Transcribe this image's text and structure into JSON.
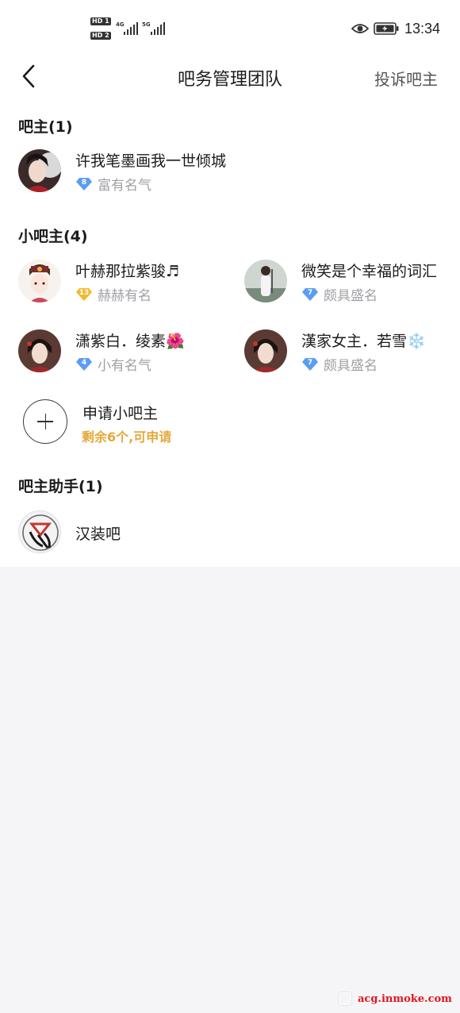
{
  "status_bar": {
    "hd1": "HD 1",
    "hd2": "HD 2",
    "net1": "4G",
    "net2": "5G",
    "time": "13:34",
    "icons": [
      "eye-icon",
      "battery-charging-icon"
    ]
  },
  "nav": {
    "title": "吧务管理团队",
    "complain": "投诉吧主"
  },
  "owner_section": {
    "title": "吧主(1)",
    "members": [
      {
        "name": "许我笔墨画我一世倾城",
        "level": "8",
        "level_title": "富有名气",
        "gem_color": "#5b9df2"
      }
    ]
  },
  "vice_section": {
    "title": "小吧主(4)",
    "members": [
      {
        "name": "叶赫那拉紫骏♬",
        "level": "13",
        "level_title": "赫赫有名",
        "gem_color": "#f3b92b"
      },
      {
        "name": "微笑是个幸福的词汇",
        "level": "7",
        "level_title": "颇具盛名",
        "gem_color": "#5b9df2"
      },
      {
        "name": "潇紫白．绫素🌺",
        "level": "4",
        "level_title": "小有名气",
        "gem_color": "#5b9df2"
      },
      {
        "name": "漢家女主．若雪❄️",
        "level": "7",
        "level_title": "颇具盛名",
        "gem_color": "#5b9df2"
      }
    ],
    "apply": {
      "label": "申请小吧主",
      "sub": "剩余6个,可申请"
    }
  },
  "assistant_section": {
    "title": "吧主助手(1)",
    "members": [
      {
        "name": "汉装吧"
      }
    ]
  },
  "watermark": "acg.inmoke.com"
}
